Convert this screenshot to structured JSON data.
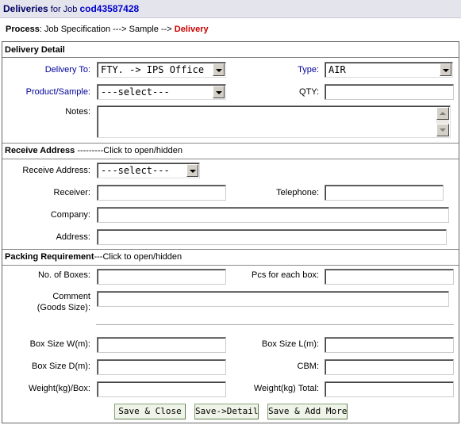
{
  "header": {
    "title": "Deliveries",
    "for_text": " for Job ",
    "job_code": "cod43587428"
  },
  "process": {
    "label": "Process",
    "steps": ": Job Specification ---> Sample --> ",
    "current": "Delivery"
  },
  "delivery_detail": {
    "heading": "Delivery Detail",
    "delivery_to_label": "Delivery To:",
    "delivery_to_value": "FTY. -> IPS Office",
    "type_label": "Type:",
    "type_value": "AIR",
    "product_label": "Product/Sample:",
    "product_value": "---select---",
    "qty_label": "QTY:",
    "qty_value": "",
    "notes_label": "Notes:",
    "notes_value": ""
  },
  "receive_address": {
    "heading": "Receive Address",
    "toggle_hint": " ---------Click to open/hidden",
    "receive_label": "Receive Address:",
    "receive_value": "---select---",
    "receiver_label": "Receiver:",
    "receiver_value": "",
    "telephone_label": "Telephone:",
    "telephone_value": "",
    "company_label": "Company:",
    "company_value": "",
    "address_label": "Address:",
    "address_value": ""
  },
  "packing": {
    "heading": "Packing Requirement",
    "toggle_hint": "---Click to open/hidden",
    "boxes_label": "No. of Boxes:",
    "boxes_value": "",
    "pcs_label": "Pcs for each box:",
    "pcs_value": "",
    "comment_label_1": "Comment",
    "comment_label_2": "(Goods Size):",
    "comment_value": "",
    "box_w_label": "Box Size W(m):",
    "box_w_value": "",
    "box_l_label": "Box Size L(m):",
    "box_l_value": "",
    "box_d_label": "Box Size D(m):",
    "box_d_value": "",
    "cbm_label": "CBM:",
    "cbm_value": "",
    "weight_box_label": "Weight(kg)/Box:",
    "weight_box_value": "",
    "weight_total_label": "Weight(kg) Total:",
    "weight_total_value": ""
  },
  "buttons": {
    "save_close": "Save & Close",
    "save_detail": "Save->Detail",
    "save_add_more": "Save & Add More"
  },
  "colors": {
    "title_blue": "#000066",
    "job_blue": "#0000cc",
    "current_step_red": "#cc0000",
    "label_blue": "#000099"
  }
}
